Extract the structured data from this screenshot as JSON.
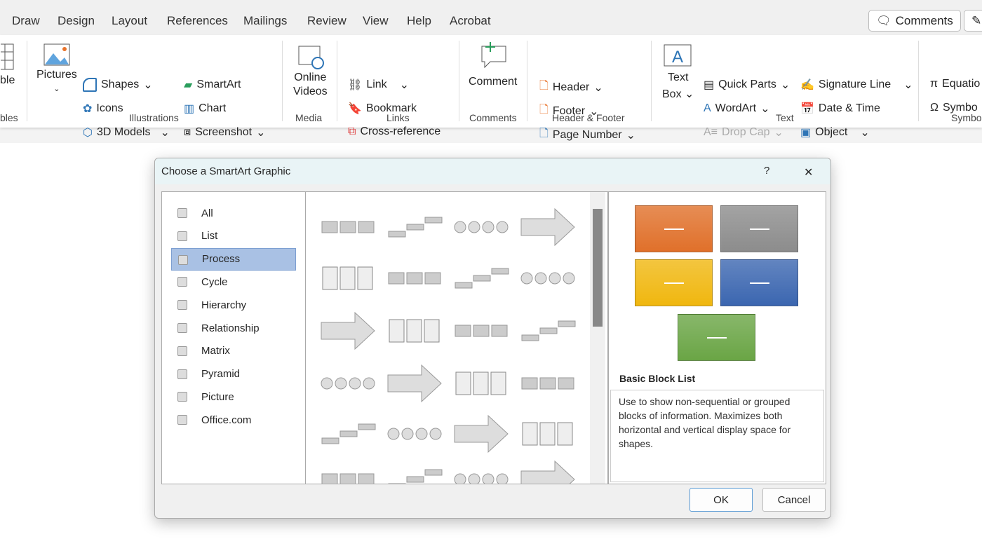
{
  "tabs": [
    "Draw",
    "Design",
    "Layout",
    "References",
    "Mailings",
    "Review",
    "View",
    "Help",
    "Acrobat"
  ],
  "top": {
    "comments": "Comments"
  },
  "ribbon": {
    "table_partial": "ble",
    "tables_group_partial": "bles",
    "pictures": "Pictures",
    "shapes": "Shapes",
    "icons": "Icons",
    "models": "3D Models",
    "smartart": "SmartArt",
    "chart": "Chart",
    "screenshot": "Screenshot",
    "illustrations": "Illustrations",
    "online_videos_1": "Online",
    "online_videos_2": "Videos",
    "media": "Media",
    "link": "Link",
    "bookmark": "Bookmark",
    "crossref": "Cross-reference",
    "links": "Links",
    "comment": "Comment",
    "comments_group": "Comments",
    "header": "Header",
    "footer": "Footer",
    "page_number": "Page Number",
    "hf_group": "Header & Footer",
    "textbox_1": "Text",
    "textbox_2": "Box",
    "quick_parts": "Quick Parts",
    "wordart": "WordArt",
    "drop_cap": "Drop Cap",
    "signature": "Signature Line",
    "datetime": "Date & Time",
    "object": "Object",
    "text_group": "Text",
    "equation": "Equatio",
    "symbol": "Symbo",
    "symbols_group": "Symbo"
  },
  "dialog": {
    "title": "Choose a SmartArt Graphic",
    "help": "?",
    "close": "✕",
    "categories": [
      {
        "label": "All"
      },
      {
        "label": "List"
      },
      {
        "label": "Process",
        "selected": true
      },
      {
        "label": "Cycle"
      },
      {
        "label": "Hierarchy"
      },
      {
        "label": "Relationship"
      },
      {
        "label": "Matrix"
      },
      {
        "label": "Pyramid"
      },
      {
        "label": "Picture"
      },
      {
        "label": "Office.com"
      }
    ],
    "preview": {
      "name": "Basic Block List",
      "description": "Use to show non-sequential or grouped blocks of information. Maximizes both horizontal and vertical display space for shapes.",
      "colors": [
        "#e0702a",
        "#8c8c8c",
        "#f0b70f",
        "#3b66b0",
        "#6aa545"
      ]
    },
    "ok": "OK",
    "cancel": "Cancel"
  }
}
